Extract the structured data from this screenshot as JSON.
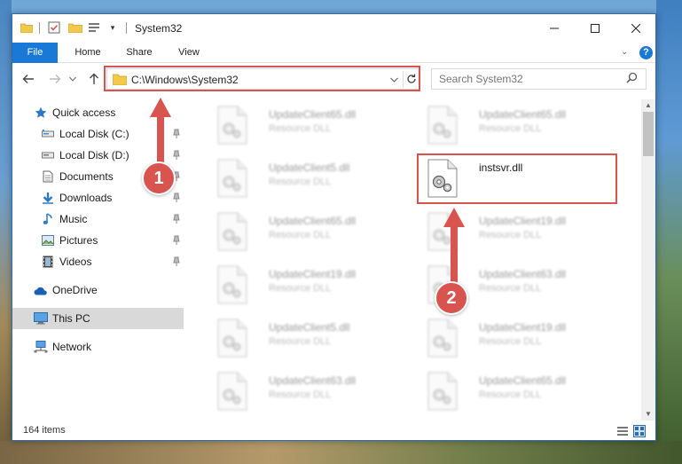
{
  "window": {
    "title": "System32",
    "colors": {
      "accent": "#1a79d6",
      "highlight": "#d9534f",
      "selected": "#d9d9d9"
    }
  },
  "quick_access_toolbar": {
    "icons": [
      "folder-icon",
      "properties-icon",
      "new-folder-icon",
      "customize-icon"
    ],
    "dropdown": "▾"
  },
  "window_controls": {
    "minimize": "—",
    "maximize": "☐",
    "close": "✕"
  },
  "ribbon": {
    "tabs": [
      {
        "label": "File"
      },
      {
        "label": "Home"
      },
      {
        "label": "Share"
      },
      {
        "label": "View"
      }
    ],
    "expand": "⌄",
    "help": "?"
  },
  "navigation": {
    "back": "←",
    "forward": "→",
    "recent": "⌄",
    "up": "↑",
    "address": "C:\\Windows\\System32",
    "address_dropdown": "⌄",
    "search_placeholder": "Search System32"
  },
  "sidebar": {
    "items": [
      {
        "label": "Quick access",
        "icon": "star-icon"
      },
      {
        "label": "Local Disk (C:)",
        "icon": "drive-icon",
        "pinned": true
      },
      {
        "label": "Local Disk (D:)",
        "icon": "drive-icon",
        "pinned": true
      },
      {
        "label": "Documents",
        "icon": "documents-icon",
        "pinned": true
      },
      {
        "label": "Downloads",
        "icon": "downloads-icon",
        "pinned": true
      },
      {
        "label": "Music",
        "icon": "music-icon",
        "pinned": true
      },
      {
        "label": "Pictures",
        "icon": "pictures-icon",
        "pinned": true
      },
      {
        "label": "Videos",
        "icon": "videos-icon",
        "pinned": true
      },
      {
        "label": "OneDrive",
        "icon": "onedrive-icon"
      },
      {
        "label": "This PC",
        "icon": "computer-icon",
        "selected": true
      },
      {
        "label": "Network",
        "icon": "network-icon"
      }
    ]
  },
  "files": [
    {
      "name": "UpdateClient65.dll",
      "type": "Resource DLL",
      "blurred": true
    },
    {
      "name": "UpdateClient65.dll",
      "type": "Resource DLL",
      "blurred": true
    },
    {
      "name": "UpdateClient5.dll",
      "type": "Resource DLL",
      "blurred": true
    },
    {
      "name": "instsvr.dll",
      "type": "",
      "blurred": false
    },
    {
      "name": "UpdateClient65.dll",
      "type": "Resource DLL",
      "blurred": true
    },
    {
      "name": "UpdateClient19.dll",
      "type": "Resource DLL",
      "blurred": true
    },
    {
      "name": "UpdateClient19.dll",
      "type": "Resource DLL",
      "blurred": true
    },
    {
      "name": "UpdateClient63.dll",
      "type": "Resource DLL",
      "blurred": true
    },
    {
      "name": "UpdateClient5.dll",
      "type": "Resource DLL",
      "blurred": true
    },
    {
      "name": "UpdateClient19.dll",
      "type": "Resource DLL",
      "blurred": true
    },
    {
      "name": "UpdateClient63.dll",
      "type": "Resource DLL",
      "blurred": true
    },
    {
      "name": "UpdateClient65.dll",
      "type": "Resource DLL",
      "blurred": true
    }
  ],
  "status": {
    "item_count": "164 items"
  },
  "annotations": {
    "step1": "1",
    "step2": "2"
  }
}
